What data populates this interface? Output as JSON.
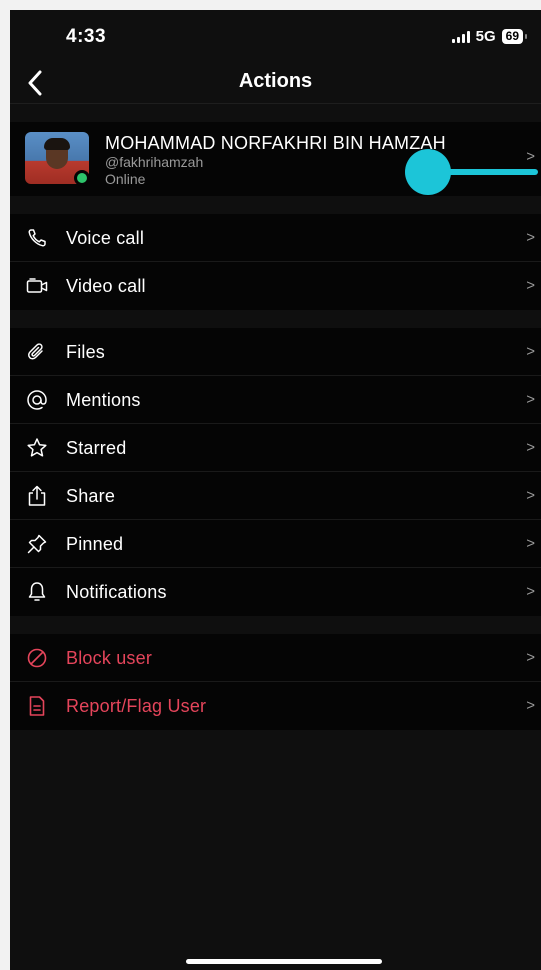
{
  "status_bar": {
    "time": "4:33",
    "network": "5G",
    "battery": "69"
  },
  "nav": {
    "title": "Actions",
    "back_icon": "chevron-left-icon"
  },
  "profile": {
    "name": "MOHAMMAD NORFAKHRI BIN HAMZAH",
    "handle": "@fakhrihamzah",
    "status": "Online",
    "status_color": "#2ec46b"
  },
  "colors": {
    "accent": "#1cc5d8",
    "danger": "#e5455b",
    "background": "#0f0f0f"
  },
  "sections": [
    {
      "items": [
        {
          "label": "Voice call",
          "icon": "phone-icon"
        },
        {
          "label": "Video call",
          "icon": "video-icon"
        }
      ]
    },
    {
      "items": [
        {
          "label": "Files",
          "icon": "paperclip-icon"
        },
        {
          "label": "Mentions",
          "icon": "at-icon"
        },
        {
          "label": "Starred",
          "icon": "star-icon"
        },
        {
          "label": "Share",
          "icon": "share-icon"
        },
        {
          "label": "Pinned",
          "icon": "pin-icon"
        },
        {
          "label": "Notifications",
          "icon": "bell-icon"
        }
      ]
    },
    {
      "items": [
        {
          "label": "Block user",
          "icon": "block-icon"
        },
        {
          "label": "Report/Flag User",
          "icon": "report-icon"
        }
      ]
    }
  ],
  "chevron": ">"
}
